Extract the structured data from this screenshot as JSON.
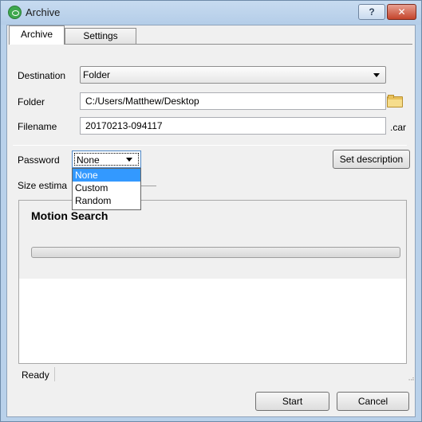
{
  "window": {
    "title": "Archive",
    "help_label": "?",
    "close_label": "✕"
  },
  "tabs": [
    {
      "label": "Archive",
      "active": true
    },
    {
      "label": "Settings",
      "active": false
    }
  ],
  "destination": {
    "label": "Destination",
    "value": "Folder"
  },
  "folder": {
    "label": "Folder",
    "value": "C:/Users/Matthew/Desktop"
  },
  "filename": {
    "label": "Filename",
    "value": "20170213-094117",
    "extension": ".car"
  },
  "password": {
    "label": "Password",
    "value": "None",
    "options": [
      "None",
      "Custom",
      "Random"
    ],
    "highlighted": "None"
  },
  "set_description_label": "Set description",
  "size_estimate_label": "Size estima",
  "progress": {
    "title": "Motion Search",
    "fraction": 0
  },
  "status": {
    "text": "Ready",
    "grip": "⠠⠴"
  },
  "buttons": {
    "start": "Start",
    "cancel": "Cancel"
  },
  "colors": {
    "accent": "#3399ff",
    "progress_fill": "#06b025",
    "title_bar": "#b9d1ea"
  }
}
